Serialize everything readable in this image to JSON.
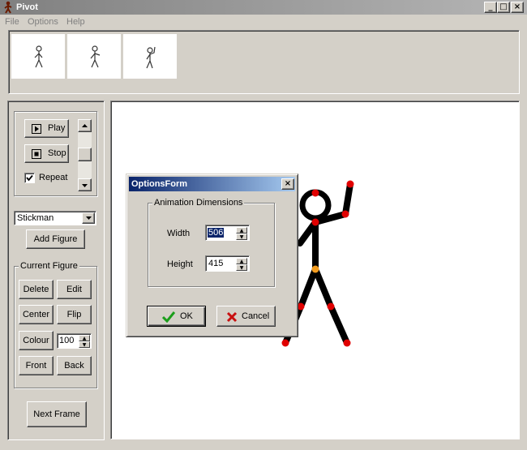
{
  "window": {
    "title": "Pivot",
    "controls": [
      "_",
      "□",
      "×"
    ]
  },
  "menu": [
    "File",
    "Options",
    "Help"
  ],
  "playback": {
    "play_label": "Play",
    "stop_label": "Stop",
    "repeat_label": "Repeat",
    "repeat_checked": true
  },
  "figure_select": {
    "selected": "Stickman",
    "add_label": "Add Figure"
  },
  "current_figure": {
    "group_label": "Current Figure",
    "delete_label": "Delete",
    "edit_label": "Edit",
    "center_label": "Center",
    "flip_label": "Flip",
    "colour_label": "Colour",
    "size_value": "100",
    "front_label": "Front",
    "back_label": "Back"
  },
  "next_frame_label": "Next Frame",
  "dialog": {
    "title": "OptionsForm",
    "group_label": "Animation Dimensions",
    "width_label": "Width",
    "width_value": "506",
    "height_label": "Height",
    "height_value": "415",
    "ok_label": "OK",
    "cancel_label": "Cancel"
  },
  "icons": [
    "stickman-app-icon",
    "play-icon",
    "stop-icon",
    "check-icon",
    "x-icon",
    "chevron-down-icon",
    "scroll-up-icon",
    "scroll-down-icon"
  ],
  "colors": {
    "joint_red": "#e00000",
    "joint_orange": "#f39c1f",
    "dialog_title": "#0a246a"
  }
}
